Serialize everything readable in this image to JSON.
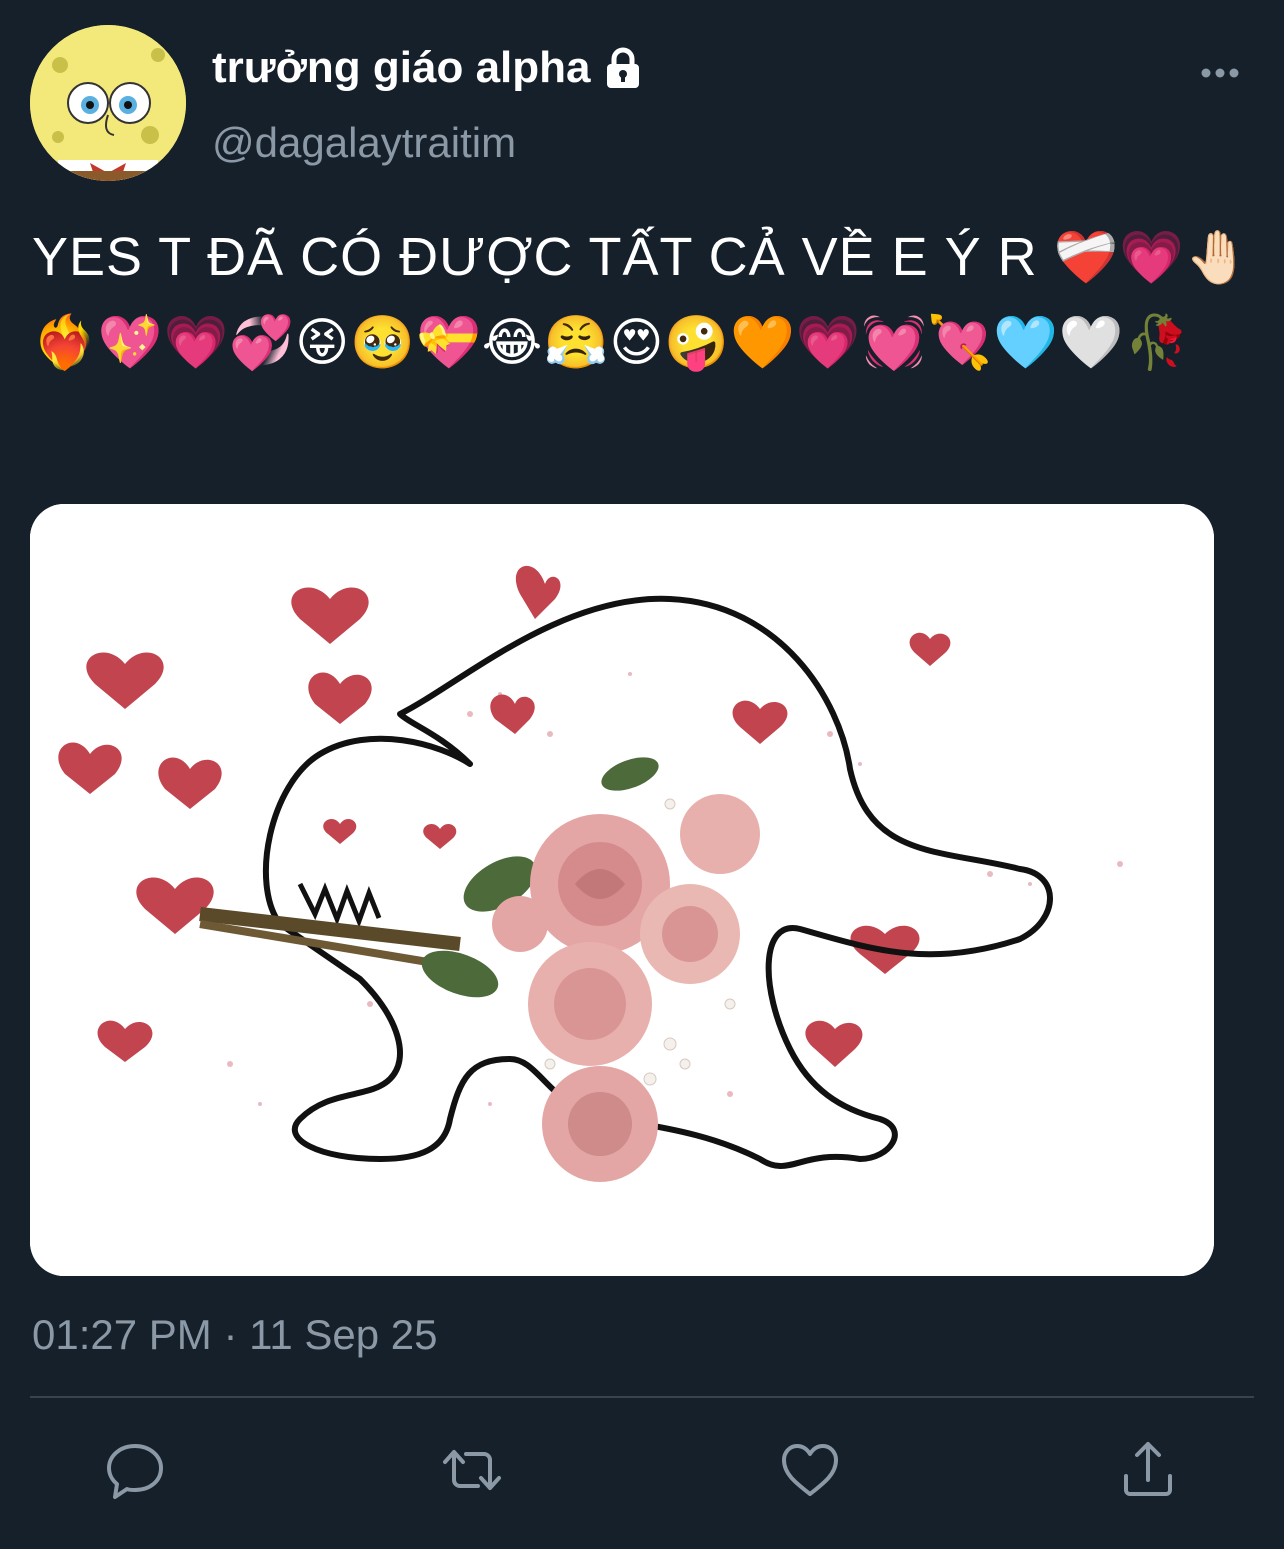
{
  "author": {
    "display_name": "trưởng giáo alpha",
    "handle": "@dagalaytraitim",
    "protected_icon": "lock-icon",
    "avatar_icon": "spongebob-avatar"
  },
  "tweet": {
    "text_main": "YES T ĐÃ CÓ ĐƯỢC TẤT CẢ VỀ E Ý R ",
    "emojis": "❤️‍🩹💗🤚🏻❤️‍🔥💖💗💞😝🥹💝😂😤😍🤪🧡💗💓💘🩵🤍🥀",
    "timestamp": "01:27 PM · 11 Sep 25"
  },
  "media": {
    "description_icon": "meme-image"
  },
  "actions": [
    {
      "name": "reply-icon"
    },
    {
      "name": "retweet-icon"
    },
    {
      "name": "like-icon"
    },
    {
      "name": "share-icon"
    }
  ],
  "colors": {
    "background": "#15202b",
    "text": "#ffffff",
    "secondary": "#8b98a5",
    "divider": "#38444d"
  }
}
